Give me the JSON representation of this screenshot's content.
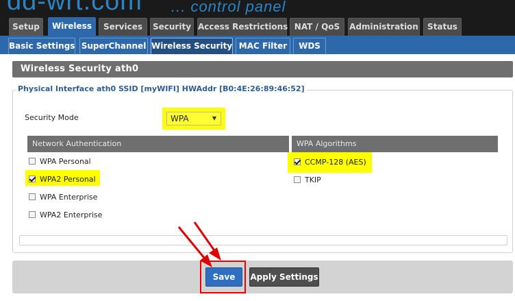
{
  "header": {
    "logo": "dd-wrt.com",
    "subtitle": "... control panel"
  },
  "main_tabs": [
    {
      "label": "Setup",
      "active": false
    },
    {
      "label": "Wireless",
      "active": true
    },
    {
      "label": "Services",
      "active": false
    },
    {
      "label": "Security",
      "active": false
    },
    {
      "label": "Access Restrictions",
      "active": false
    },
    {
      "label": "NAT / QoS",
      "active": false
    },
    {
      "label": "Administration",
      "active": false
    },
    {
      "label": "Status",
      "active": false
    }
  ],
  "sub_tabs": [
    {
      "label": "Basic Settings",
      "active": false
    },
    {
      "label": "SuperChannel",
      "active": false
    },
    {
      "label": "Wireless Security",
      "active": true
    },
    {
      "label": "MAC Filter",
      "active": false
    },
    {
      "label": "WDS",
      "active": false
    }
  ],
  "section": {
    "title": "Wireless Security ath0",
    "legend": "Physical Interface ath0 SSID [myWIFI] HWAddr [B0:4E:26:89:46:52]",
    "security_mode_label": "Security Mode",
    "security_mode_value": "WPA",
    "network_auth": {
      "header": "Network Authentication",
      "options": [
        {
          "label": "WPA Personal",
          "checked": false
        },
        {
          "label": "WPA2 Personal",
          "checked": true
        },
        {
          "label": "WPA Enterprise",
          "checked": false
        },
        {
          "label": "WPA2 Enterprise",
          "checked": false
        }
      ]
    },
    "wpa_algorithms": {
      "header": "WPA Algorithms",
      "options": [
        {
          "label": "CCMP-128 (AES)",
          "checked": true
        },
        {
          "label": "TKIP",
          "checked": false
        }
      ]
    }
  },
  "footer": {
    "save_label": "Save",
    "apply_label": "Apply Settings"
  },
  "colors": {
    "accent": "#2d68aa",
    "highlight": "#ffff00",
    "annotation": "#e00000"
  }
}
